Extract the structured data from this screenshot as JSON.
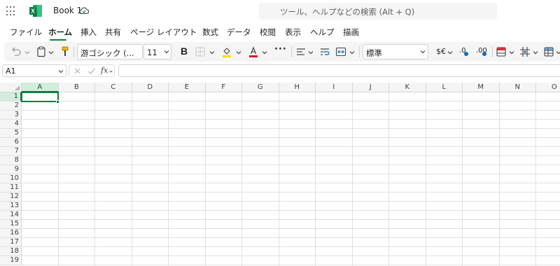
{
  "app": {
    "title": "Book 1",
    "search_placeholder": "ツール、ヘルプなどの検索 (Alt + Q)"
  },
  "tabs": [
    {
      "label": "ファイル"
    },
    {
      "label": "ホーム"
    },
    {
      "label": "挿入"
    },
    {
      "label": "共有"
    },
    {
      "label": "ページ レイアウト"
    },
    {
      "label": "数式"
    },
    {
      "label": "データ"
    },
    {
      "label": "校閲"
    },
    {
      "label": "表示"
    },
    {
      "label": "ヘルプ"
    },
    {
      "label": "描画"
    }
  ],
  "active_tab": "ホーム",
  "ribbon": {
    "font_name": "游ゴシック (...",
    "font_size": "11",
    "number_format": "標準",
    "bold_label": "B",
    "more_label": "···",
    "currency_label": "$€",
    "increase_decimal_label": ".0",
    "decrease_decimal_label": ".00",
    "font_color": "#e81123",
    "fill_color": "#ffd800"
  },
  "formula_bar": {
    "name_box": "A1",
    "fx_label": "fx",
    "value": ""
  },
  "sheet": {
    "columns": [
      "A",
      "B",
      "C",
      "D",
      "E",
      "F",
      "G",
      "H",
      "I",
      "J",
      "K",
      "L",
      "M",
      "N",
      "O"
    ],
    "rows": [
      "1",
      "2",
      "3",
      "4",
      "5",
      "6",
      "7",
      "8",
      "9",
      "10",
      "11",
      "12",
      "13",
      "14",
      "15",
      "16",
      "17",
      "18",
      "19"
    ],
    "active_cell": "A1",
    "accent": "#117c3e"
  }
}
